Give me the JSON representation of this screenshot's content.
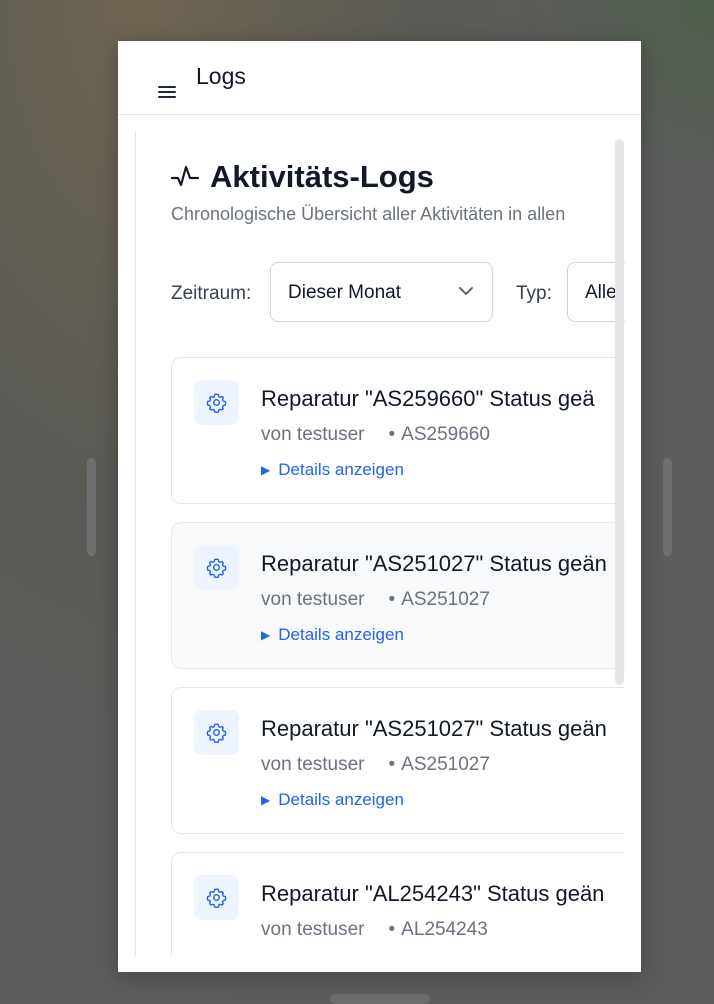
{
  "window": {
    "title": "Logs"
  },
  "page": {
    "title": "Aktivitäts-Logs",
    "subtitle": "Chronologische Übersicht aller Aktivitäten in allen"
  },
  "filters": {
    "zeitraum_label": "Zeitraum:",
    "zeitraum_value": "Dieser Monat",
    "typ_label": "Typ:",
    "typ_value": "Alle"
  },
  "logs": [
    {
      "title": "Reparatur \"AS259660\" Status geä",
      "user": "von testuser",
      "dot": "•",
      "ref": "AS259660",
      "details": "Details anzeigen",
      "icon": "gear-icon"
    },
    {
      "title": "Reparatur \"AS251027\" Status geän",
      "user": "von testuser",
      "dot": "•",
      "ref": "AS251027",
      "details": "Details anzeigen",
      "icon": "gear-icon"
    },
    {
      "title": "Reparatur \"AS251027\" Status geän",
      "user": "von testuser",
      "dot": "•",
      "ref": "AS251027",
      "details": "Details anzeigen",
      "icon": "gear-icon"
    },
    {
      "title": "Reparatur \"AL254243\" Status geän",
      "user": "von testuser",
      "dot": "•",
      "ref": "AL254243",
      "icon": "gear-icon"
    }
  ],
  "colors": {
    "accent": "#2563eb",
    "icon_bg": "#eef4ff",
    "muted": "#6b7280"
  }
}
